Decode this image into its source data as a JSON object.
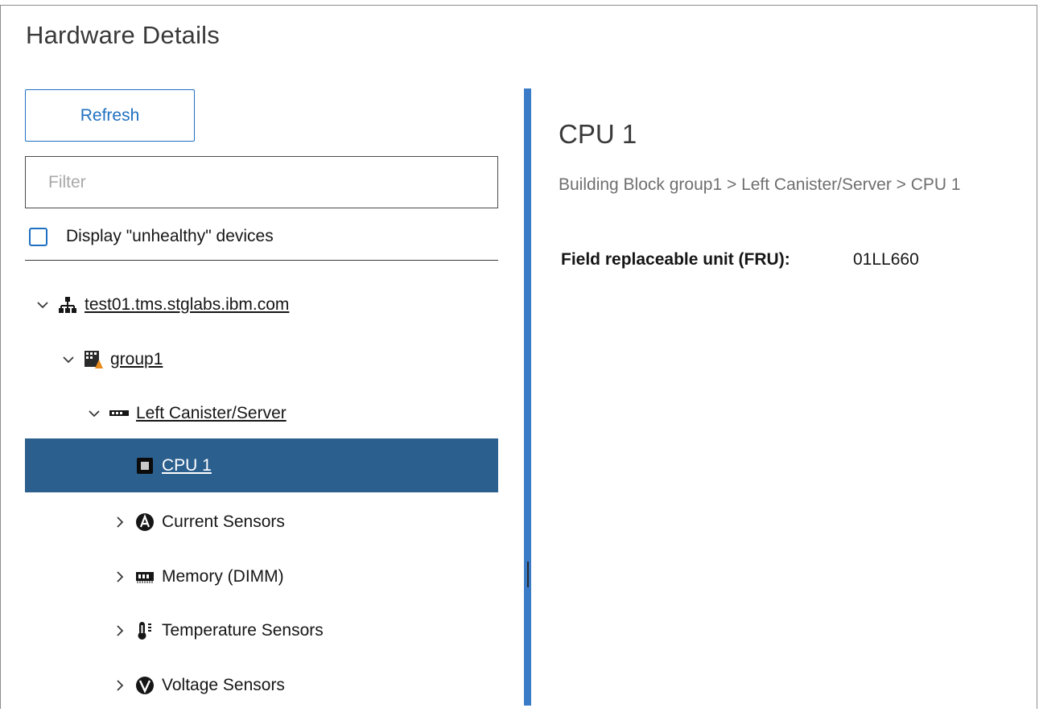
{
  "page": {
    "title": "Hardware Details"
  },
  "toolbar": {
    "refresh_label": "Refresh"
  },
  "filter": {
    "placeholder": "Filter",
    "value": ""
  },
  "unhealthy_checkbox": {
    "label": "Display \"unhealthy\" devices",
    "checked": false
  },
  "tree": {
    "items": [
      {
        "label": "test01.tms.stglabs.ibm.com",
        "icon": "network-cluster-icon",
        "expanded": true,
        "level": 0
      },
      {
        "label": "group1",
        "icon": "building-block-icon",
        "expanded": true,
        "level": 1
      },
      {
        "label": "Left Canister/Server",
        "icon": "server-icon",
        "expanded": true,
        "level": 2
      },
      {
        "label": "CPU 1",
        "icon": "chip-icon",
        "selected": true,
        "level": 3
      },
      {
        "label": "Current Sensors",
        "icon": "ampere-sensor-icon",
        "expanded": false,
        "level": 3
      },
      {
        "label": "Memory (DIMM)",
        "icon": "memory-dimm-icon",
        "expanded": false,
        "level": 3
      },
      {
        "label": "Temperature Sensors",
        "icon": "thermometer-icon",
        "expanded": false,
        "level": 3
      },
      {
        "label": "Voltage Sensors",
        "icon": "voltage-sensor-icon",
        "expanded": false,
        "level": 3
      }
    ]
  },
  "detail": {
    "title": "CPU 1",
    "breadcrumb": "Building Block group1 > Left Canister/Server > CPU 1",
    "fru_label": "Field replaceable unit (FRU):",
    "fru_value": "01LL660"
  },
  "colors": {
    "accent": "#1f70c1",
    "selected_row": "#2b5f8e",
    "splitter": "#3a7bc8"
  }
}
